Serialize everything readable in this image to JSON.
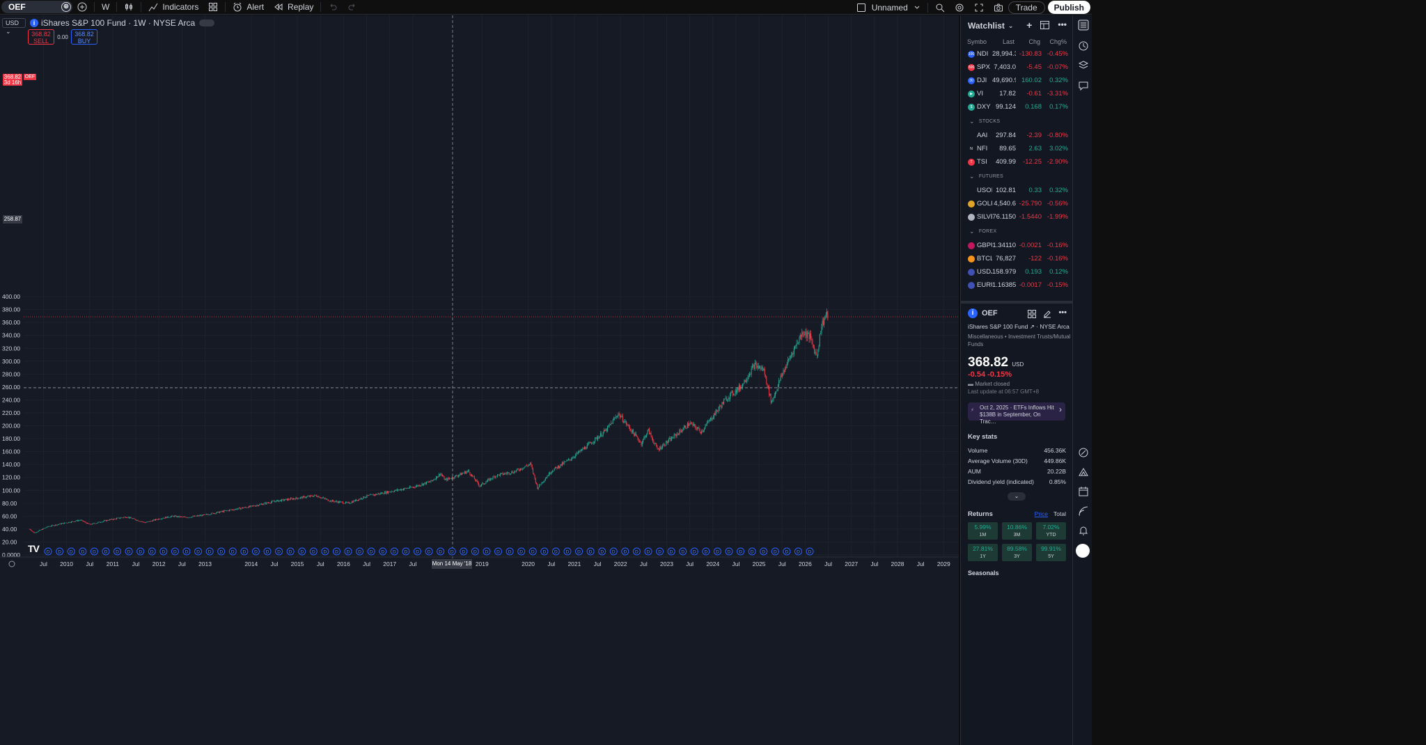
{
  "toolbar": {
    "symbol": "OEF",
    "interval": "W",
    "indicators_label": "Indicators",
    "alert_label": "Alert",
    "replay_label": "Replay",
    "layout_name": "Unnamed",
    "trade_label": "Trade",
    "publish_label": "Publish"
  },
  "chart": {
    "currency": "USD",
    "legend_title": "iShares S&P 100 Fund · 1W · NYSE Arca",
    "sell_price": "368.82",
    "sell_label": "SELL",
    "spread": "0.00",
    "buy_price": "368.82",
    "buy_label": "BUY",
    "last_price_tag": "368.82",
    "last_price_countdown": "3d 16h",
    "last_price_symbol": "OEF",
    "crosshair_price": "258.87",
    "crosshair_date": "Mon 14 May '18",
    "colors": {
      "up": "#22ab94",
      "down": "#f23645",
      "accent": "#2962ff",
      "background": "#161a25"
    }
  },
  "chart_data": {
    "type": "candlestick",
    "y_ticks": [
      "400.00",
      "380.00",
      "360.00",
      "340.00",
      "320.00",
      "300.00",
      "280.00",
      "260.00",
      "240.00",
      "220.00",
      "200.00",
      "180.00",
      "160.00",
      "140.00",
      "120.00",
      "100.00",
      "80.00",
      "60.00",
      "40.00",
      "20.00",
      "0.0000"
    ],
    "ylim": [
      0,
      400
    ],
    "x_ticks": [
      {
        "label": "Jul",
        "t": 2009.5
      },
      {
        "label": "2010",
        "t": 2010
      },
      {
        "label": "Jul",
        "t": 2010.5
      },
      {
        "label": "2011",
        "t": 2011
      },
      {
        "label": "Jul",
        "t": 2011.5
      },
      {
        "label": "2012",
        "t": 2012
      },
      {
        "label": "Jul",
        "t": 2012.5
      },
      {
        "label": "2013",
        "t": 2013
      },
      {
        "label": "2014",
        "t": 2014
      },
      {
        "label": "Jul",
        "t": 2014.5
      },
      {
        "label": "2015",
        "t": 2015
      },
      {
        "label": "Jul",
        "t": 2015.5
      },
      {
        "label": "2016",
        "t": 2016
      },
      {
        "label": "Jul",
        "t": 2016.5
      },
      {
        "label": "2017",
        "t": 2017
      },
      {
        "label": "Jul",
        "t": 2017.5
      },
      {
        "label": "2019",
        "t": 2019
      },
      {
        "label": "2020",
        "t": 2020
      },
      {
        "label": "Jul",
        "t": 2020.5
      },
      {
        "label": "2021",
        "t": 2021
      },
      {
        "label": "Jul",
        "t": 2021.5
      },
      {
        "label": "2022",
        "t": 2022
      },
      {
        "label": "Jul",
        "t": 2022.5
      },
      {
        "label": "2023",
        "t": 2023
      },
      {
        "label": "Jul",
        "t": 2023.5
      },
      {
        "label": "2024",
        "t": 2024
      },
      {
        "label": "Jul",
        "t": 2024.5
      },
      {
        "label": "2025",
        "t": 2025
      },
      {
        "label": "Jul",
        "t": 2025.5
      },
      {
        "label": "2026",
        "t": 2026
      },
      {
        "label": "Jul",
        "t": 2026.5
      },
      {
        "label": "2027",
        "t": 2027
      },
      {
        "label": "Jul",
        "t": 2027.5
      },
      {
        "label": "2028",
        "t": 2028
      },
      {
        "label": "Jul",
        "t": 2028.5
      },
      {
        "label": "2029",
        "t": 2029
      }
    ],
    "price_path": [
      [
        2009.2,
        40
      ],
      [
        2009.3,
        34
      ],
      [
        2009.6,
        44
      ],
      [
        2010.0,
        50
      ],
      [
        2010.3,
        54
      ],
      [
        2010.5,
        47
      ],
      [
        2010.9,
        54
      ],
      [
        2011.3,
        59
      ],
      [
        2011.7,
        50
      ],
      [
        2012.0,
        56
      ],
      [
        2012.3,
        60
      ],
      [
        2012.6,
        58
      ],
      [
        2013.0,
        62
      ],
      [
        2013.5,
        69
      ],
      [
        2014.0,
        75
      ],
      [
        2014.5,
        83
      ],
      [
        2015.0,
        88
      ],
      [
        2015.4,
        92
      ],
      [
        2015.7,
        84
      ],
      [
        2016.1,
        80
      ],
      [
        2016.5,
        91
      ],
      [
        2017.0,
        98
      ],
      [
        2017.5,
        105
      ],
      [
        2017.9,
        114
      ],
      [
        2018.1,
        126
      ],
      [
        2018.2,
        116
      ],
      [
        2018.4,
        121
      ],
      [
        2018.7,
        130
      ],
      [
        2018.95,
        107
      ],
      [
        2019.3,
        123
      ],
      [
        2019.7,
        129
      ],
      [
        2020.05,
        141
      ],
      [
        2020.2,
        104
      ],
      [
        2020.5,
        130
      ],
      [
        2020.9,
        148
      ],
      [
        2021.3,
        170
      ],
      [
        2021.7,
        194
      ],
      [
        2021.95,
        219
      ],
      [
        2022.2,
        196
      ],
      [
        2022.45,
        173
      ],
      [
        2022.6,
        193
      ],
      [
        2022.8,
        163
      ],
      [
        2023.1,
        180
      ],
      [
        2023.5,
        204
      ],
      [
        2023.75,
        191
      ],
      [
        2024.0,
        215
      ],
      [
        2024.3,
        243
      ],
      [
        2024.6,
        260
      ],
      [
        2024.9,
        294
      ],
      [
        2025.1,
        287
      ],
      [
        2025.27,
        236
      ],
      [
        2025.5,
        280
      ],
      [
        2025.75,
        318
      ],
      [
        2025.95,
        346
      ],
      [
        2026.1,
        338
      ],
      [
        2026.25,
        307
      ],
      [
        2026.35,
        355
      ],
      [
        2026.45,
        372
      ],
      [
        2026.5,
        368.82
      ]
    ],
    "event_markers": "D"
  },
  "watchlist": {
    "title": "Watchlist",
    "columns": [
      "Symbo",
      "Last",
      "Chg",
      "Chg%"
    ],
    "groups": [
      {
        "section": "",
        "rows": [
          {
            "badge": "100",
            "badge_color": "#2962ff",
            "sym": "NDI",
            "last": "28,994.3",
            "chg": "-130.83",
            "chgp": "-0.45%",
            "dir": "dn"
          },
          {
            "badge": "500",
            "badge_color": "#f23645",
            "sym": "SPX",
            "last": "7,403.0",
            "chg": "-5.45",
            "chgp": "-0.07%",
            "dir": "dn"
          },
          {
            "badge": "30",
            "badge_color": "#2962ff",
            "sym": "DJI",
            "last": "49,690.9",
            "chg": "160.02",
            "chgp": "0.32%",
            "dir": "up"
          },
          {
            "badge": "▶",
            "badge_color": "#22ab94",
            "sym": "VI",
            "last": "17.82",
            "chg": "-0.61",
            "chgp": "-3.31%",
            "dir": "dn"
          },
          {
            "badge": "$",
            "badge_color": "#22ab94",
            "sym": "DXY",
            "last": "99.124",
            "chg": "0.168",
            "chgp": "0.17%",
            "dir": "up"
          }
        ]
      },
      {
        "section": "STOCKS",
        "rows": [
          {
            "badge": "",
            "badge_color": "#131722",
            "sym": "AAI",
            "last": "297.84",
            "chg": "-2.39",
            "chgp": "-0.80%",
            "dir": "dn"
          },
          {
            "badge": "N",
            "badge_color": "#131722",
            "sym": "NFI",
            "last": "89.65",
            "chg": "2.63",
            "chgp": "3.02%",
            "dir": "up"
          },
          {
            "badge": "T",
            "badge_color": "#f23645",
            "sym": "TSI",
            "last": "409.99",
            "chg": "-12.25",
            "chgp": "-2.90%",
            "dir": "dn"
          }
        ]
      },
      {
        "section": "FUTURES",
        "rows": [
          {
            "badge": "",
            "badge_color": "#131722",
            "sym": "USOI",
            "last": "102.81",
            "chg": "0.33",
            "chgp": "0.32%",
            "dir": "up"
          },
          {
            "badge": "",
            "badge_color": "#e0a526",
            "sym": "GOLI",
            "last": "4,540.6",
            "chg": "-25.790",
            "chgp": "-0.56%",
            "dir": "dn"
          },
          {
            "badge": "",
            "badge_color": "#b2b5be",
            "sym": "SILVE",
            "last": "76.1150",
            "chg": "-1.5440",
            "chgp": "-1.99%",
            "dir": "dn"
          }
        ]
      },
      {
        "section": "FOREX",
        "rows": [
          {
            "badge": "",
            "badge_color": "#c2185b",
            "sym": "GBPU",
            "last": "1.34110",
            "chg": "-0.0021",
            "chgp": "-0.16%",
            "dir": "dn"
          },
          {
            "badge": "",
            "badge_color": "#f7931a",
            "sym": "BTCL",
            "last": "76,827",
            "chg": "-122",
            "chgp": "-0.16%",
            "dir": "dn"
          },
          {
            "badge": "",
            "badge_color": "#3f51b5",
            "sym": "USDJ",
            "last": "158.979",
            "chg": "0.193",
            "chgp": "0.12%",
            "dir": "up"
          },
          {
            "badge": "",
            "badge_color": "#3f51b5",
            "sym": "EURU",
            "last": "1.16385",
            "chg": "-0.0017",
            "chgp": "-0.15%",
            "dir": "dn"
          }
        ]
      }
    ]
  },
  "details": {
    "symbol": "OEF",
    "name": "iShares S&P 100 Fund",
    "exchange": "NYSE Arca",
    "category": "Miscellaneous • Investment Trusts/Mutual Funds",
    "price": "368.82",
    "currency": "USD",
    "change": "-0.54",
    "change_pct": "-0.15%",
    "market_status": "Market closed",
    "last_update": "Last update at 06:57 GMT+8",
    "news": "Oct 2, 2025 · ETFs Inflows Hit $138B in September, On Trac…",
    "key_stats_title": "Key stats",
    "key_stats": [
      {
        "label": "Volume",
        "value": "456.36K"
      },
      {
        "label": "Average Volume (30D)",
        "value": "449.86K"
      },
      {
        "label": "AUM",
        "value": "20.22B"
      },
      {
        "label": "Dividend yield (indicated)",
        "value": "0.85%"
      }
    ],
    "returns_title": "Returns",
    "returns_tab_price": "Price",
    "returns_tab_total": "Total",
    "returns": [
      {
        "value": "5.99%",
        "label": "1M"
      },
      {
        "value": "10.86%",
        "label": "3M"
      },
      {
        "value": "7.02%",
        "label": "YTD"
      },
      {
        "value": "27.81%",
        "label": "1Y"
      },
      {
        "value": "89.58%",
        "label": "3Y"
      },
      {
        "value": "99.91%",
        "label": "5Y"
      }
    ],
    "seasonals_title": "Seasonals"
  }
}
